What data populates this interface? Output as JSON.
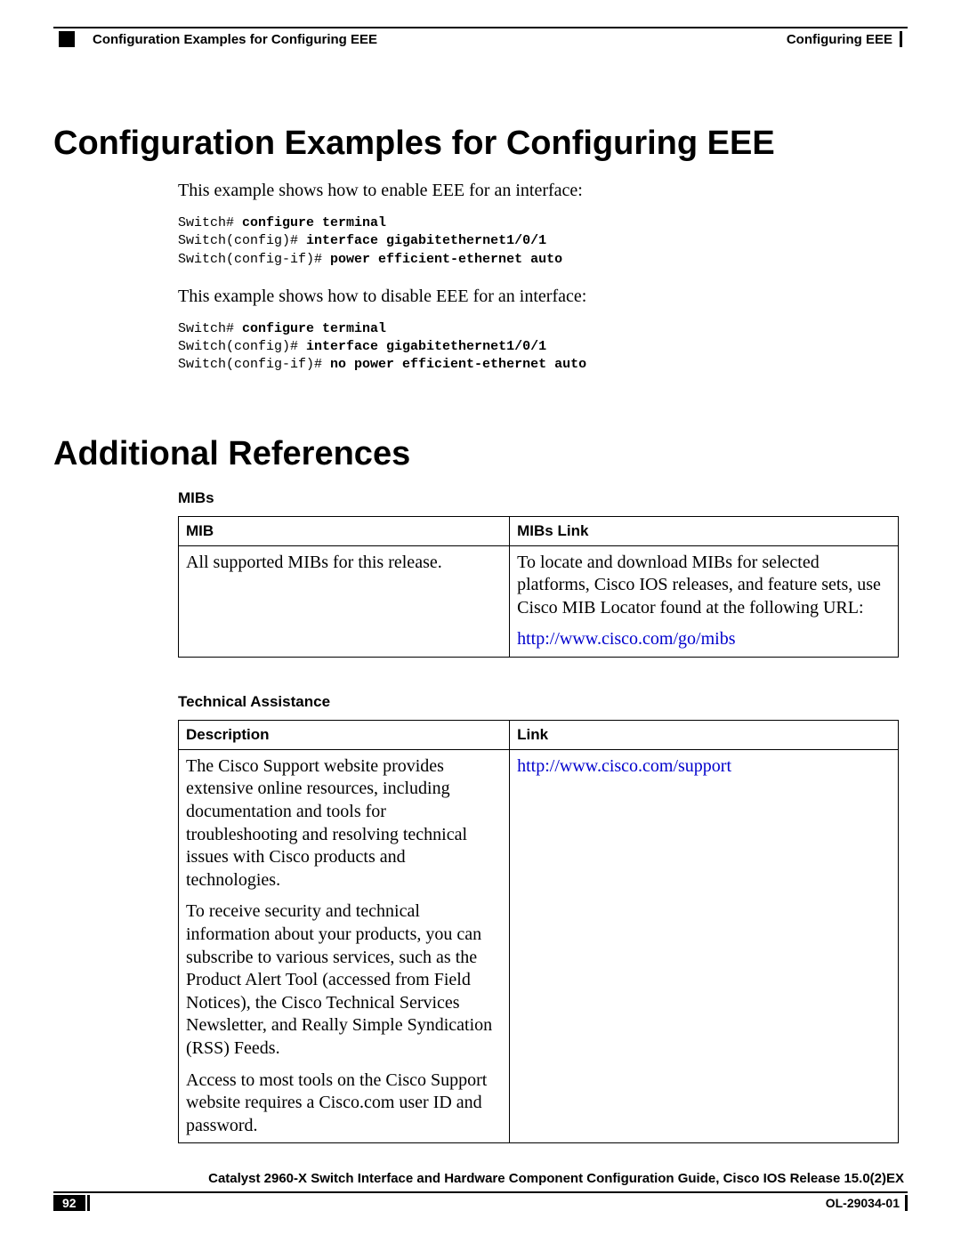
{
  "header": {
    "breadcrumb": "Configuration Examples for Configuring EEE",
    "chapter": "Configuring EEE"
  },
  "section1": {
    "title": "Configuration Examples for Configuring EEE",
    "para1": "This example shows how to enable EEE for an interface:",
    "code1_prompt1": "Switch# ",
    "code1_cmd1": "configure terminal",
    "code1_prompt2": "Switch(config)# ",
    "code1_cmd2": "interface gigabitethernet1/0/1",
    "code1_prompt3": "Switch(config-if)# ",
    "code1_cmd3": "power efficient-ethernet auto",
    "para2": "This example shows how to disable EEE for an interface:",
    "code2_prompt1": "Switch# ",
    "code2_cmd1": "configure terminal",
    "code2_prompt2": "Switch(config)# ",
    "code2_cmd2": "interface gigabitethernet1/0/1",
    "code2_prompt3": "Switch(config-if)# ",
    "code2_cmd3": "no power efficient-ethernet auto"
  },
  "section2": {
    "title": "Additional References",
    "mibs": {
      "heading": "MIBs",
      "th1": "MIB",
      "th2": "MIBs Link",
      "row1_col1": "All supported MIBs for this release.",
      "row1_col2_p1": "To locate and download MIBs for selected platforms, Cisco IOS releases, and feature sets, use Cisco MIB Locator found at the following URL:",
      "row1_col2_link": "http://www.cisco.com/go/mibs"
    },
    "tech": {
      "heading": "Technical Assistance",
      "th1": "Description",
      "th2": "Link",
      "row1_col1_p1": "The Cisco Support website provides extensive online resources, including documentation and tools for troubleshooting and resolving technical issues with Cisco products and technologies.",
      "row1_col1_p2": "To receive security and technical information about your products, you can subscribe to various services, such as the Product Alert Tool (accessed from Field Notices), the Cisco Technical Services Newsletter, and Really Simple Syndication (RSS) Feeds.",
      "row1_col1_p3": "Access to most tools on the Cisco Support website requires a Cisco.com user ID and password.",
      "row1_col2_link": "http://www.cisco.com/support"
    }
  },
  "footer": {
    "book_title": "Catalyst 2960-X Switch Interface and Hardware Component Configuration Guide, Cisco IOS Release 15.0(2)EX",
    "page_num": "92",
    "doc_id": "OL-29034-01"
  }
}
